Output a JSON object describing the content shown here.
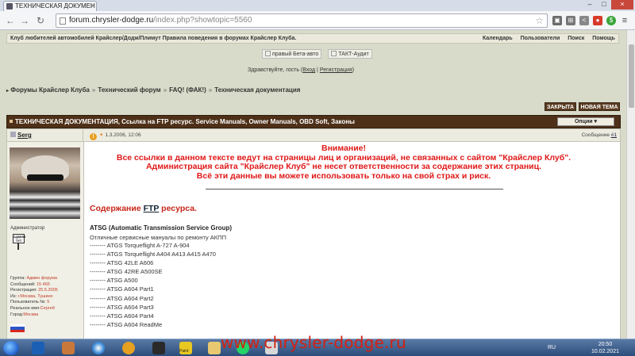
{
  "browser": {
    "tab_title": "ТЕХНИЧЕСКАЯ ДОКУМЕН",
    "url_host": "forum.chrysler-dodge.ru",
    "url_path": "/index.php?showtopic=5560"
  },
  "topnav": {
    "left": "Клуб любителей автомобилей Крайслер/Додж/Плимут   Правила поведения в форумах Крайслер Клуба.",
    "items": [
      "Календарь",
      "Пользователи",
      "Поиск",
      "Помощь"
    ]
  },
  "banners": [
    "правый Бета-авто",
    "ТАКТ-Аудит"
  ],
  "greeting": {
    "prefix": "Здравствуйте, гость (",
    "login": "Вход",
    "sep": " | ",
    "register": "Регистрация",
    "suffix": ")"
  },
  "breadcrumb": [
    "Форумы Крайслер Клуба",
    "Технический форум",
    "FAQ! (ФАК!)",
    "Техническая документация"
  ],
  "breadcrumb_sep": "»",
  "buttons": {
    "closed": "ЗАКРЫТА",
    "new_topic": "НОВАЯ ТЕМА",
    "options": "Опции ▾"
  },
  "topic_title": "ТЕХНИЧЕСКАЯ ДОКУМЕНТАЦИЯ, Ссылка на FTP ресурс. Service Manuals, Owner Manuals, OBD Soft, Законы",
  "post": {
    "author": "Serg",
    "date": "1.3.2006, 12:06",
    "number_label": "Сообщение ",
    "number_link": "#1",
    "role": "Администратор",
    "badge": "АДМИН ТУТ",
    "profile": [
      {
        "k": "Группа: ",
        "v": "Админ форума"
      },
      {
        "k": "Сообщений: ",
        "v": "15 465"
      },
      {
        "k": "Регистрация: ",
        "v": "25.5.2005"
      },
      {
        "k": "Из: ",
        "v": "г.Москва, Тушино"
      },
      {
        "k": "Пользователь №: ",
        "v": "5"
      },
      {
        "k": "Реальное имя:",
        "v": "Сергей"
      },
      {
        "k": "Город:",
        "v": "Москва"
      }
    ],
    "flag_colors": [
      "#ffffff",
      "#2a54c8",
      "#d8281e"
    ],
    "notice_lines": [
      "Внимание!",
      "Все ссылки в данном тексте ведут на страницы лиц и организаций, не связанных с сайтом \"Крайслер Клуб\".",
      "Администрация сайта \"Крайслер Клуб\" не несет ответственности за содержание этих страниц.",
      "Всё эти данные вы можете использовать только на свой страх и риск."
    ],
    "section_prefix": "Содержание ",
    "section_ftp": "FTP",
    "section_suffix": " ресурса.",
    "atsg_title": "ATSG (Automatic Transmission Service Group)",
    "atsg_desc": "Отличные сервисные мануалы по ремонту АКПП",
    "items": [
      "-------- ATGS Torqueflight A-727 A-904",
      "-------- ATGS Torqueflight A404 A413 A415 A470",
      "-------- ATSG 42LE A606",
      "-------- ATSG 42RE A500SE",
      "-------- ATSG A500",
      "-------- ATSG A604 Part1",
      "-------- ATSG A604 Part2",
      "-------- ATSG A604 Part3",
      "-------- ATSG A604 Part4",
      "-------- ATSG A604 ReadMe"
    ]
  },
  "watermark": "www.chrysler-dodge.ru",
  "taskbar": {
    "lang": "RU",
    "time": "20:50",
    "date": "10.02.2021",
    "app_label": "Paint"
  }
}
